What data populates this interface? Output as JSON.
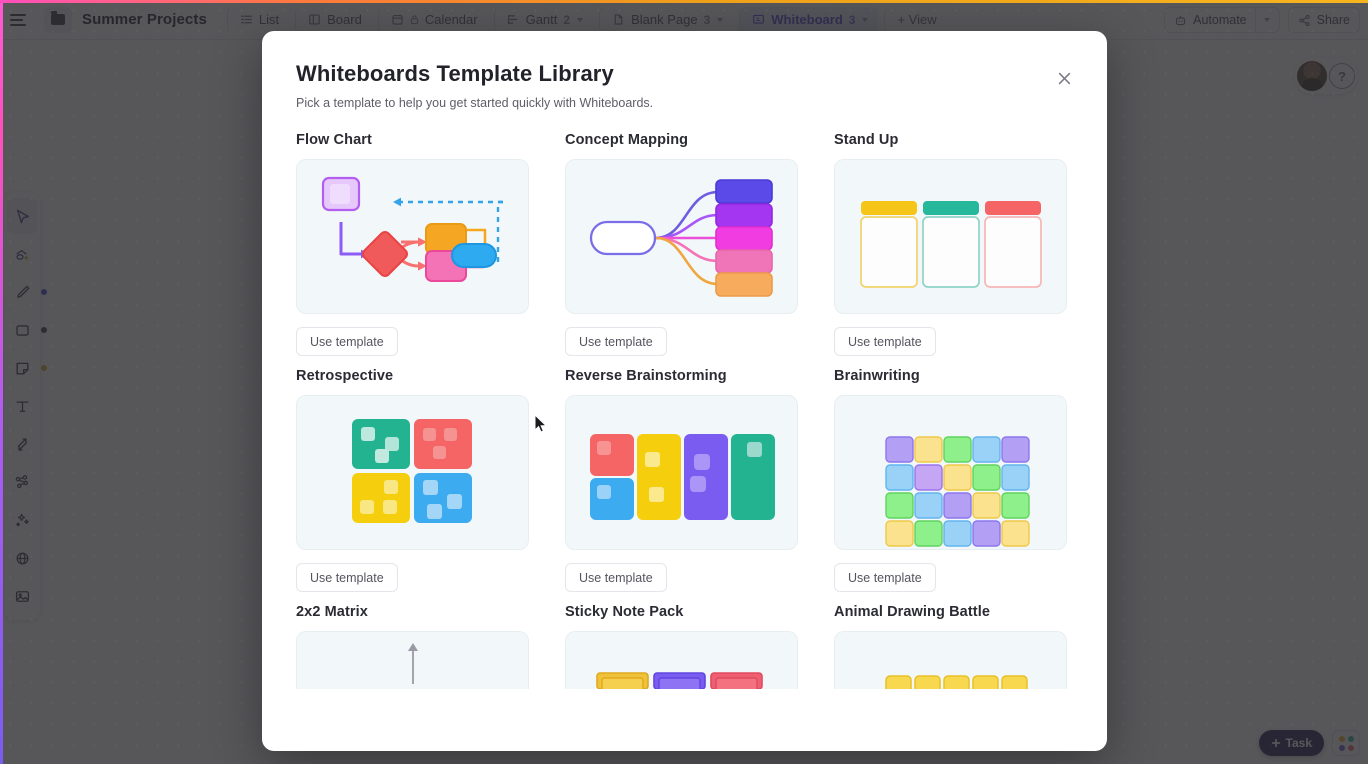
{
  "topbar": {
    "menu_icon": "hamburger-icon",
    "space_icon": "folder-icon",
    "project_title": "Summer Projects",
    "tabs": [
      {
        "label": "List",
        "icon": "list-icon",
        "count": "",
        "locked": false,
        "active": false
      },
      {
        "label": "Board",
        "icon": "board-icon",
        "count": "",
        "locked": false,
        "active": false
      },
      {
        "label": "Calendar",
        "icon": "calendar-icon",
        "count": "",
        "locked": true,
        "active": false
      },
      {
        "label": "Gantt",
        "icon": "gantt-icon",
        "count": "2",
        "locked": false,
        "active": false
      },
      {
        "label": "Blank Page",
        "icon": "doc-icon",
        "count": "3",
        "locked": false,
        "active": false
      },
      {
        "label": "Whiteboard",
        "icon": "whiteboard-icon",
        "count": "3",
        "locked": false,
        "active": true
      }
    ],
    "add_view_label": "+ View",
    "automate_label": "Automate",
    "automate_icon": "robot-icon",
    "share_label": "Share",
    "share_icon": "share-icon",
    "help_icon": "question-mark-icon",
    "avatar": "user-avatar"
  },
  "toolbar": {
    "items": [
      {
        "name": "select-tool",
        "icon": "cursor-icon",
        "selected": true,
        "dot": ""
      },
      {
        "name": "shapes-tool",
        "icon": "shapes-add-icon",
        "selected": false,
        "dot": ""
      },
      {
        "name": "pen-tool",
        "icon": "pen-icon",
        "selected": false,
        "dot": "#4b3fd6"
      },
      {
        "name": "rectangle-tool",
        "icon": "square-icon",
        "selected": false,
        "dot": "#3b3b45"
      },
      {
        "name": "sticky-note-tool",
        "icon": "sticky-note-icon",
        "selected": false,
        "dot": "#d9a437"
      },
      {
        "name": "text-tool",
        "icon": "text-icon",
        "selected": false,
        "dot": ""
      },
      {
        "name": "connector-tool",
        "icon": "connector-icon",
        "selected": false,
        "dot": ""
      },
      {
        "name": "mindmap-tool",
        "icon": "mindmap-icon",
        "selected": false,
        "dot": ""
      },
      {
        "name": "ai-tool",
        "icon": "magic-wand-icon",
        "selected": false,
        "dot": ""
      },
      {
        "name": "web-tool",
        "icon": "globe-icon",
        "selected": false,
        "dot": ""
      },
      {
        "name": "image-tool",
        "icon": "image-icon",
        "selected": false,
        "dot": ""
      }
    ]
  },
  "footer": {
    "task_label": "Task",
    "task_icon": "plus-icon",
    "apps_icon": "apps-grid-icon"
  },
  "modal": {
    "title": "Whiteboards Template Library",
    "subtitle": "Pick a template to help you get started quickly with Whiteboards.",
    "close_icon": "close-icon",
    "use_template_label": "Use template",
    "templates": [
      {
        "name": "Flow Chart",
        "preview": "flow-chart"
      },
      {
        "name": "Concept Mapping",
        "preview": "concept-map"
      },
      {
        "name": "Stand Up",
        "preview": "stand-up"
      },
      {
        "name": "Retrospective",
        "preview": "retrospective"
      },
      {
        "name": "Reverse Brainstorming",
        "preview": "reverse-brainstorming"
      },
      {
        "name": "Brainwriting",
        "preview": "brainwriting"
      },
      {
        "name": "2x2 Matrix",
        "preview": "matrix-2x2"
      },
      {
        "name": "Sticky Note Pack",
        "preview": "sticky-note-pack"
      },
      {
        "name": "Animal Drawing Battle",
        "preview": "animal-drawing-battle"
      }
    ]
  },
  "colors": {
    "accent_purple": "#5b4bdb",
    "preview_bg": "#f2f8fa",
    "overlay": "rgba(40,40,44,0.78)",
    "edge_gradient_left": "#ff5ad4",
    "task_button": "#2b2359"
  }
}
